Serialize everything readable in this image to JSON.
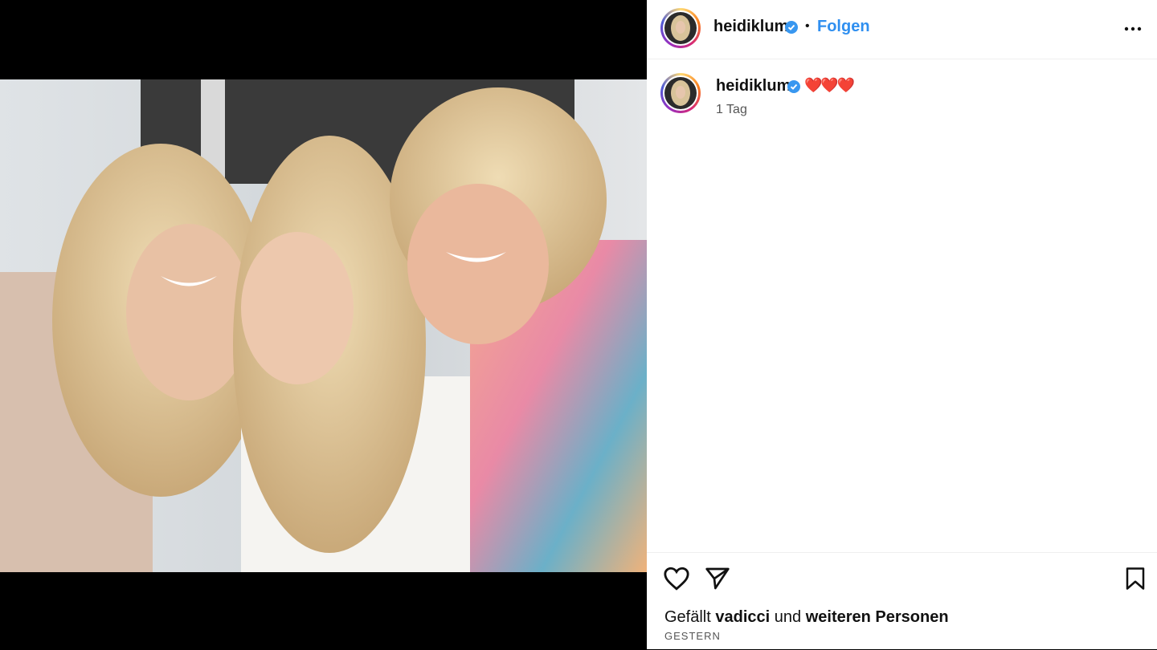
{
  "post": {
    "username": "heidiklum",
    "follow_label": "Folgen",
    "separator": "•",
    "caption": "❤️❤️❤️",
    "age": "1 Tag"
  },
  "likes": {
    "prefix": "Gefällt",
    "liker": "vadicci",
    "connector": "und",
    "others": "weiteren Personen"
  },
  "date_label": "GESTERN",
  "icons": {
    "verified": "verified-badge-icon",
    "more": "more-options-icon",
    "like": "heart-icon",
    "share": "share-icon",
    "save": "bookmark-icon"
  },
  "colors": {
    "accent": "#2f8ff0",
    "verified": "#3897f0"
  }
}
